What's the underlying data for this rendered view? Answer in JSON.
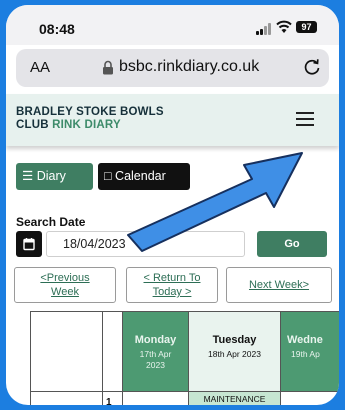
{
  "status_bar": {
    "time": "08:48",
    "battery": "97",
    "icons": [
      "signal-icon",
      "wifi-icon",
      "battery-icon"
    ]
  },
  "browser": {
    "text_size_label": "AA",
    "url": "bsbc.rinkdiary.co.uk",
    "icons": [
      "lock-icon",
      "reload-icon"
    ]
  },
  "site": {
    "title_line1": "BRADLEY STOKE BOWLS",
    "title_line2_part1": "CLUB",
    "title_line2_part2": "RINK DIARY",
    "accent_color": "#3d8b6a",
    "menu_icon": "hamburger-menu-icon"
  },
  "view_buttons": {
    "diary_label": "Diary",
    "calendar_label": "Calendar"
  },
  "search": {
    "label": "Search Date",
    "date_value": "18/04/2023",
    "go_label": "Go"
  },
  "week_nav": {
    "previous_line1": "<Previous",
    "previous_line2": "Week",
    "return_line1": "< Return To",
    "return_line2": "Today >",
    "next_label": "Next Week>"
  },
  "table": {
    "days": [
      {
        "name": "Monday",
        "date_line1": "17th Apr",
        "date_line2": "2023"
      },
      {
        "name": "Tuesday",
        "date_line1": "18th Apr 2023",
        "date_line2": ""
      },
      {
        "name": "Wedne",
        "date_line1": "19th Ap",
        "date_line2": ""
      }
    ],
    "row_number": "1",
    "tuesday_booking": "MAINTENANCE"
  },
  "colors": {
    "brand_green": "#3f7e62",
    "header_green": "#4d9a72",
    "today_bg": "#e9f3ee",
    "annotation_arrow": "#3f8fe6",
    "background_blue": "#1c7ee0"
  }
}
